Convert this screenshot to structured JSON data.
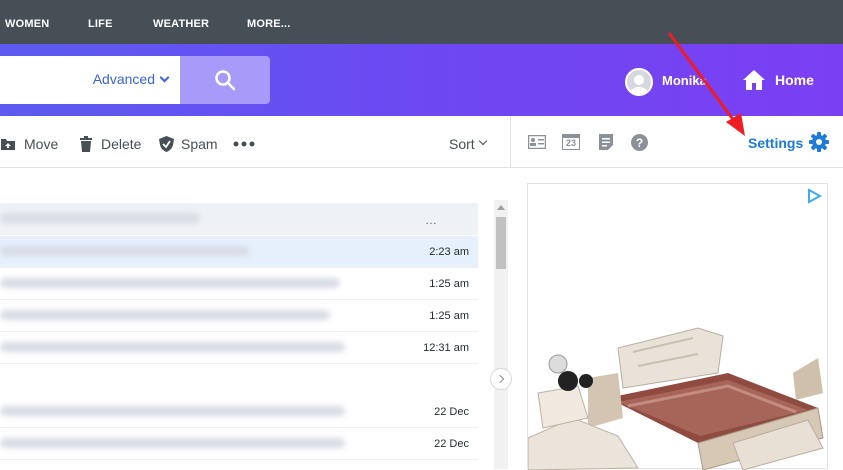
{
  "topnav": {
    "items": [
      "WOMEN",
      "LIFE",
      "WEATHER",
      "MORE..."
    ]
  },
  "header": {
    "advanced_label": "Advanced",
    "user_name": "Monika",
    "home_label": "Home"
  },
  "toolbar": {
    "move_label": "Move",
    "delete_label": "Delete",
    "spam_label": "Spam",
    "sort_label": "Sort"
  },
  "rightbar": {
    "settings_label": "Settings",
    "calendar_day": "23"
  },
  "messages": [
    {
      "time": ""
    },
    {
      "time": "2:23 am"
    },
    {
      "time": "1:25 am"
    },
    {
      "time": "1:25 am"
    },
    {
      "time": "12:31 am"
    },
    {
      "time": ""
    },
    {
      "time": "22 Dec"
    },
    {
      "time": "22 Dec"
    }
  ],
  "colors": {
    "accent": "#1d7ad6",
    "header_start": "#5b5bf0",
    "header_end": "#7b3ff3",
    "annotation": "#ee1c25"
  }
}
